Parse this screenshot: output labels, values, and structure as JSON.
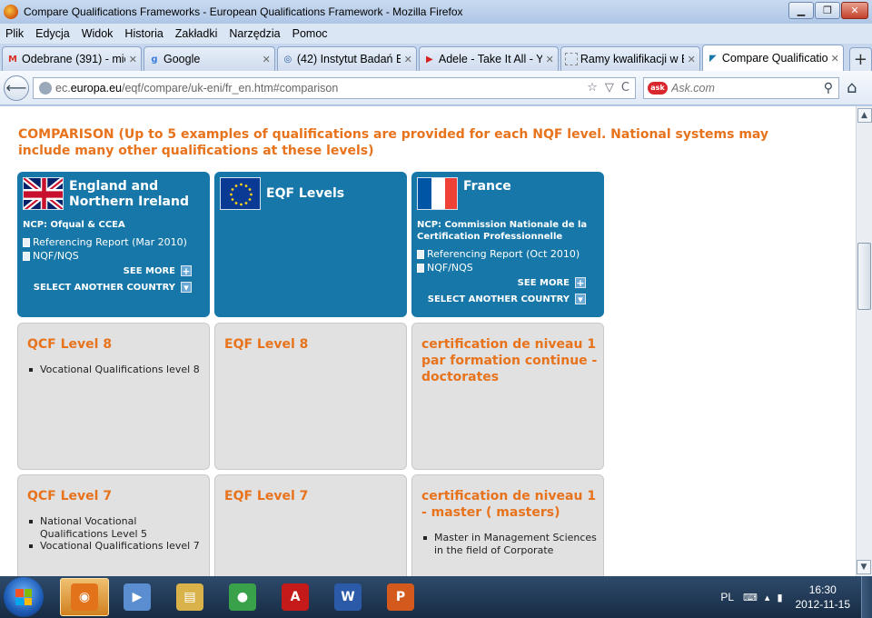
{
  "window": {
    "title": "Compare Qualifications Frameworks - European Qualifications Framework - Mozilla Firefox",
    "min": "▁",
    "max": "❐",
    "close": "✕"
  },
  "menu": [
    "Plik",
    "Edycja",
    "Widok",
    "Historia",
    "Zakładki",
    "Narzędzia",
    "Pomoc"
  ],
  "tabs": [
    {
      "label": "Odebrane (391) - mic...",
      "icon": "gmail-icon",
      "fav": "M",
      "favColor": "#d93025"
    },
    {
      "label": "Google",
      "icon": "google-icon",
      "fav": "g",
      "favColor": "#3b7ddd"
    },
    {
      "label": "(42) Instytut Badań E...",
      "icon": "page-icon",
      "fav": "◎",
      "favColor": "#2a5aa8"
    },
    {
      "label": "Adele - Take It All - Y...",
      "icon": "youtube-icon",
      "fav": "▶",
      "favColor": "#d81f1f"
    },
    {
      "label": "Ramy kwalifikacji w E...",
      "icon": "blank-page-icon",
      "fav": "",
      "favColor": "#888888"
    },
    {
      "label": "Compare Qualificatio...",
      "icon": "eqf-icon",
      "fav": "◤",
      "favColor": "#1677a8"
    }
  ],
  "tab_close": "✕",
  "newtab": "+",
  "nav": {
    "back": "⟵",
    "url_prefix": "ec.",
    "url_domain": "europa.eu",
    "url_path": "/eqf/compare/uk-eni/fr_en.htm#comparison",
    "star": "☆",
    "drop": "▽",
    "reload": "C",
    "search_placeholder": "Ask.com",
    "ask_logo": "ask",
    "search_icon": "⚲",
    "home": "⌂"
  },
  "page": {
    "heading": "COMPARISON (Up to 5 examples of qualifications are provided for each NQF level. National systems may include many other qualifications at these levels)",
    "countries": [
      {
        "name": "England and Northern Ireland",
        "ncp": "NCP: Ofqual & CCEA",
        "links": [
          "Referencing Report (Mar 2010)",
          "NQF/NQS"
        ],
        "see_more": "SEE MORE",
        "select": "SELECT ANOTHER COUNTRY"
      },
      {
        "name": "EQF Levels"
      },
      {
        "name": "France",
        "ncp": "NCP: Commission Nationale de la Certification Professionnelle",
        "links": [
          "Referencing Report (Oct 2010)",
          "NQF/NQS"
        ],
        "see_more": "SEE MORE",
        "select": "SELECT ANOTHER COUNTRY"
      }
    ],
    "plus": "+",
    "down": "▾",
    "levels": [
      {
        "title": "QCF Level 8",
        "items": [
          "Vocational Qualifications level 8"
        ]
      },
      {
        "title": "EQF Level 8",
        "items": []
      },
      {
        "title": "certification de niveau 1 par formation continue - doctorates",
        "items": []
      },
      {
        "title": "QCF Level 7",
        "items": [
          "National Vocational Qualifications Level 5",
          "Vocational Qualifications level 7"
        ]
      },
      {
        "title": "EQF Level 7",
        "items": []
      },
      {
        "title": "certification de niveau 1 - master ( masters)",
        "items": [
          "Master in Management Sciences in the field of Corporate"
        ]
      }
    ]
  },
  "scroll": {
    "up": "▲",
    "down": "▼"
  },
  "taskbar": {
    "items": [
      {
        "name": "firefox-taskbar-button",
        "icon": "firefox-icon",
        "label": "◉",
        "color": "#e2731b",
        "active": true
      },
      {
        "name": "media-player-taskbar-button",
        "icon": "media-player-icon",
        "label": "▶",
        "color": "#5a8ed1",
        "active": false
      },
      {
        "name": "explorer-taskbar-button",
        "icon": "folder-icon",
        "label": "▤",
        "color": "#d9b24a",
        "active": false
      },
      {
        "name": "chrome-taskbar-button",
        "icon": "chrome-icon",
        "label": "●",
        "color": "#3aa14b",
        "active": false
      },
      {
        "name": "acrobat-taskbar-button",
        "icon": "acrobat-icon",
        "label": "A",
        "color": "#c41a1a",
        "active": false
      },
      {
        "name": "word-taskbar-button",
        "icon": "word-icon",
        "label": "W",
        "color": "#2a5aa8",
        "active": false
      },
      {
        "name": "powerpoint-taskbar-button",
        "icon": "presentation-icon",
        "label": "P",
        "color": "#d35a1c",
        "active": false
      }
    ],
    "lang": "PL",
    "tray_icons": [
      "⌨",
      "▴",
      "▮"
    ],
    "time": "16:30",
    "date": "2012-11-15"
  }
}
